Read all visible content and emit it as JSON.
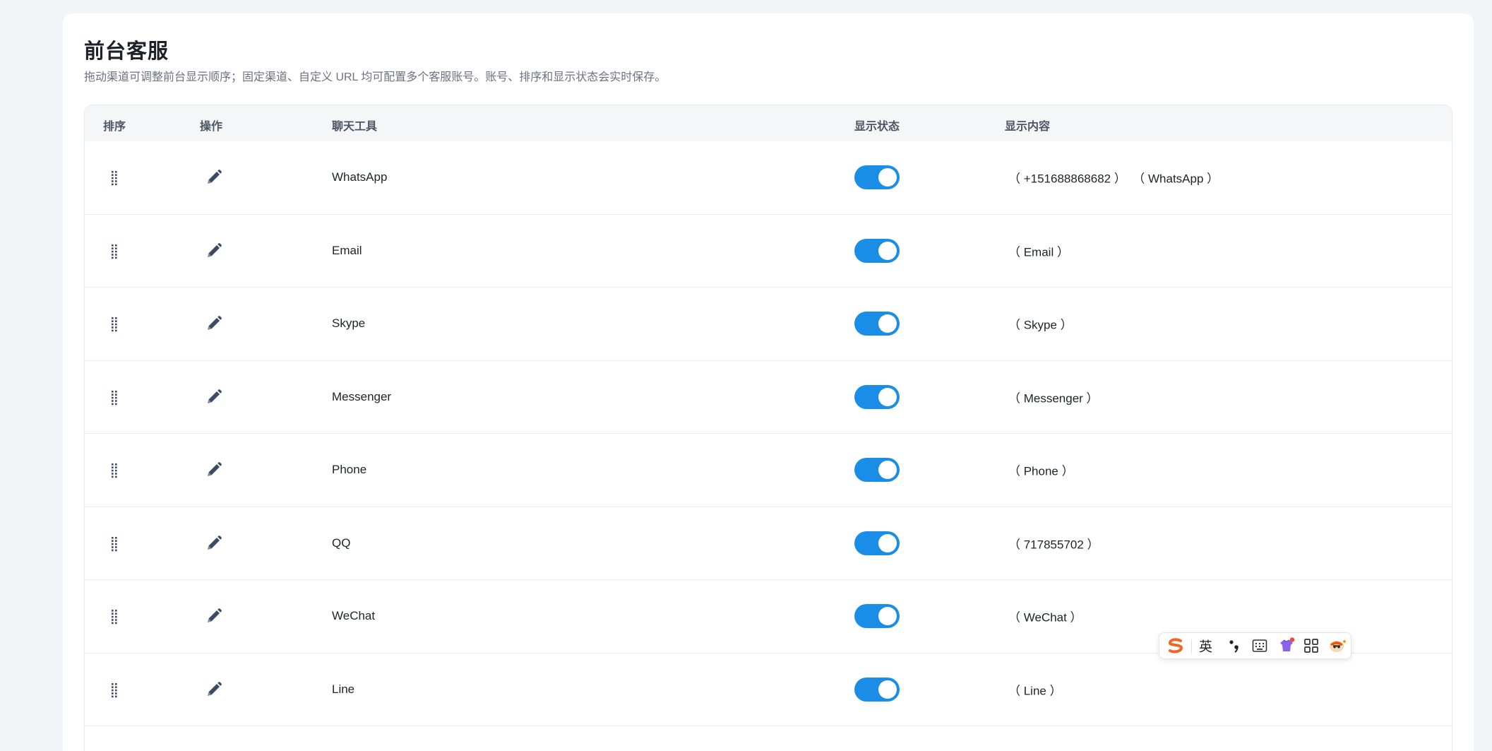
{
  "page": {
    "title": "前台客服",
    "description": "拖动渠道可调整前台显示顺序；固定渠道、自定义 URL 均可配置多个客服账号。账号、排序和显示状态会实时保存。"
  },
  "table": {
    "headers": {
      "sort": "排序",
      "action": "操作",
      "tool": "聊天工具",
      "status": "显示状态",
      "content": "显示内容"
    },
    "rows": [
      {
        "tool": "WhatsApp",
        "enabled": true,
        "content": "（ +151688868682 ）  （ WhatsApp ）"
      },
      {
        "tool": "Email",
        "enabled": true,
        "content": "（ Email ）"
      },
      {
        "tool": "Skype",
        "enabled": true,
        "content": "（ Skype ）"
      },
      {
        "tool": "Messenger",
        "enabled": true,
        "content": "（ Messenger ）"
      },
      {
        "tool": "Phone",
        "enabled": true,
        "content": "（ Phone ）"
      },
      {
        "tool": "QQ",
        "enabled": true,
        "content": "（ 717855702 ）"
      },
      {
        "tool": "WeChat",
        "enabled": true,
        "content": "（ WeChat ）"
      },
      {
        "tool": "Line",
        "enabled": true,
        "content": "（ Line ）"
      }
    ]
  },
  "ime_toolbar": {
    "language": "英",
    "icons": [
      "sogou-logo-icon",
      "punctuation-icon",
      "keyboard-icon",
      "skin-icon",
      "grid-icon",
      "mascot-icon"
    ]
  },
  "colors": {
    "toggle_on": "#1a8ee6",
    "icon": "#3d4a66",
    "header_bg": "#f5f6f8",
    "page_bg": "#f2f5f8"
  }
}
